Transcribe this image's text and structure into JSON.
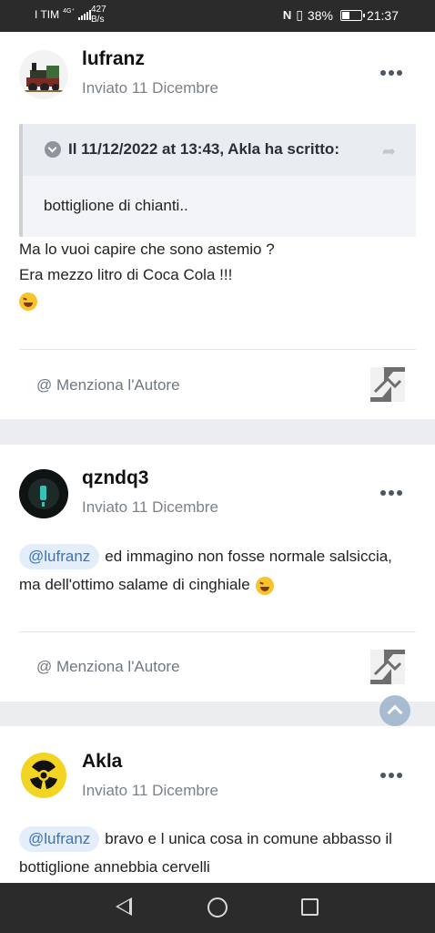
{
  "status_bar": {
    "carrier": "I TIM",
    "signal": "4G⁺",
    "speed_value": "427",
    "speed_unit": "B/s",
    "nfc": "N",
    "battery": "38%",
    "time": "21:37"
  },
  "posts": [
    {
      "author": "lufranz",
      "meta": "Inviato 11 Dicembre",
      "quote": {
        "title": "Il 11/12/2022 at 13:43, Akla ha scritto:",
        "body": "bottiglione di chianti.."
      },
      "lines": [
        "Ma lo vuoi capire che sono astemio ?",
        "Era mezzo litro di Coca Cola !!!"
      ],
      "emoji": "rolling-on-floor-laughing-emoji",
      "mention_label": "@ Menziona l'Autore"
    },
    {
      "author": "qzndq3",
      "meta": "Inviato 11 Dicembre",
      "mention_tag": "@lufranz",
      "line1": "ed immagino non fosse normale salsiccia,",
      "line2": "ma dell'ottimo salame di cinghiale",
      "emoji": "yum-emoji",
      "mention_label": "@ Menziona l'Autore"
    },
    {
      "author": "Akla",
      "meta": "Inviato 11 Dicembre",
      "mention_tag": "@lufranz",
      "line1": "bravo e l unica cosa in comune abbasso il",
      "line2": "bottiglione annebbia cervelli"
    }
  ]
}
